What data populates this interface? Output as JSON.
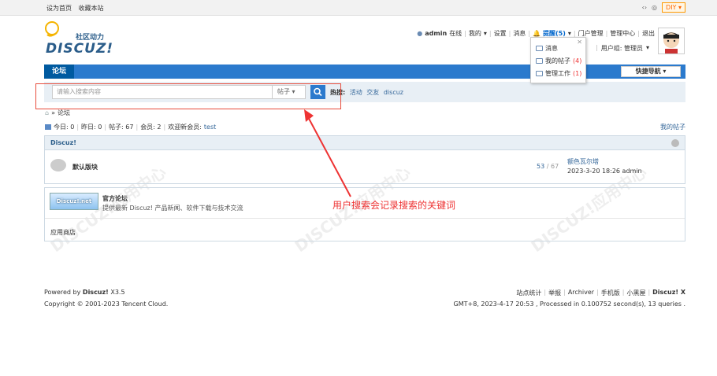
{
  "topbar": {
    "set_home": "设为首页",
    "bookmark": "收藏本站",
    "diy": "DIY"
  },
  "header": {
    "logo_tagline": "社区动力",
    "logo_text": "DISCUZ!",
    "username": "admin",
    "online": "在线",
    "links": [
      "我的",
      "设置",
      "消息"
    ],
    "remind": "提醒(5)",
    "links2": [
      "门户管理",
      "管理中心",
      "退出"
    ],
    "usergroup": "用户组: 管理员"
  },
  "dropdown": {
    "items": [
      {
        "label": "消息",
        "count": ""
      },
      {
        "label": "我的帖子",
        "count": "(4)"
      },
      {
        "label": "管理工作",
        "count": "(1)"
      }
    ]
  },
  "nav": {
    "tab": "论坛",
    "quick_nav": "快捷导航"
  },
  "search": {
    "placeholder": "请输入搜索内容",
    "type": "帖子",
    "hot_label": "热搜:",
    "hot_terms": [
      "活动",
      "交友",
      "discuz"
    ]
  },
  "breadcrumb": {
    "current": "论坛"
  },
  "stats": {
    "today": "今日: 0",
    "yesterday": "昨日: 0",
    "posts": "帖子: 67",
    "members": "会员: 2",
    "welcome": "欢迎新会员:",
    "newest": "test",
    "my_posts": "我的帖子"
  },
  "forum": {
    "section_title": "Discuz!",
    "name": "默认版块",
    "threads": "53",
    "posts": "67",
    "last_title": "额色瓦尔塔",
    "last_time": "2023-3-20 18:26",
    "last_user": "admin"
  },
  "links": {
    "logo_text": "Discuz!.net",
    "name": "官方论坛",
    "desc": "提供最新 Discuz! 产品新闻、软件下载与技术交流",
    "store": "应用商店"
  },
  "annotation": "用户搜索会记录搜索的关键词",
  "footer": {
    "powered_prefix": "Powered by",
    "powered_brand": "Discuz!",
    "version": "X3.5",
    "copyright": "Copyright © 2001-2023 Tencent Cloud.",
    "links": [
      "站点统计",
      "举报",
      "Archiver",
      "手机版",
      "小黑屋"
    ],
    "brand": "Discuz! X",
    "status": "GMT+8, 2023-4-17 20:53 , Processed in 0.100752 second(s), 13 queries ."
  },
  "colors": {
    "nav_blue": "#2b7acd",
    "annotation_red": "#e33"
  }
}
